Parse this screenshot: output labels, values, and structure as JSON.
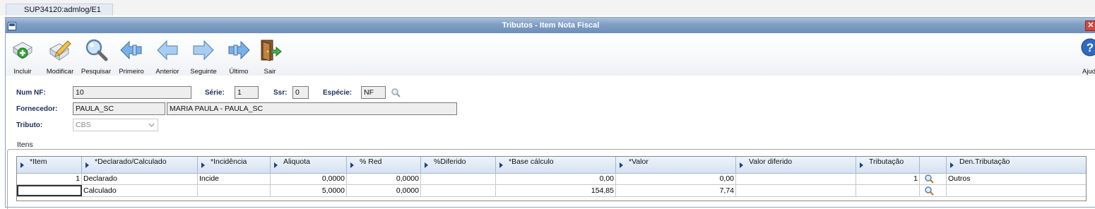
{
  "session_tab": "SUP34120:admlog/E1",
  "window": {
    "title": "Tributos - Item Nota Fiscal",
    "close_glyph": "✕"
  },
  "toolbar": {
    "items": [
      {
        "label": "Incluir",
        "icon": "add-icon"
      },
      {
        "label": "Modificar",
        "icon": "edit-icon"
      },
      {
        "label": "Pesquisar",
        "icon": "search-icon"
      },
      {
        "label": "Primeiro",
        "icon": "first-icon"
      },
      {
        "label": "Anterior",
        "icon": "previous-icon"
      },
      {
        "label": "Seguinte",
        "icon": "next-icon"
      },
      {
        "label": "Último",
        "icon": "last-icon"
      },
      {
        "label": "Sair",
        "icon": "exit-icon"
      }
    ],
    "help": {
      "label": "Ajud",
      "icon": "help-icon",
      "glyph": "?"
    }
  },
  "form": {
    "num_nf": {
      "label": "Num NF:",
      "value": "10"
    },
    "serie": {
      "label": "Série:",
      "value": "1"
    },
    "ssr": {
      "label": "Ssr:",
      "value": "0"
    },
    "especie": {
      "label": "Espécie:",
      "value": "NF"
    },
    "fornecedor": {
      "label": "Fornecedor:",
      "code": "PAULA_SC",
      "name": "MARIA PAULA - PAULA_SC"
    },
    "tributo": {
      "label": "Tributo:",
      "value": "CBS"
    }
  },
  "itens": {
    "group_label": "Itens",
    "columns": [
      "*Item",
      "*Declarado/Calculado",
      "*Incidência",
      "Aliquota",
      "% Red",
      "%Diferido",
      "*Base cálculo",
      "*Valor",
      "Valor diferido",
      "Tributação",
      "",
      "Den.Tributação"
    ],
    "rows": [
      [
        "1",
        "Declarado",
        "Incide",
        "0,0000",
        "0,0000",
        "",
        "0,00",
        "0,00",
        "",
        "1",
        "",
        "Outros"
      ],
      [
        "",
        "Calculado",
        "",
        "5,0000",
        "0,0000",
        "",
        "154,85",
        "7,74",
        "",
        "",
        "",
        ""
      ]
    ]
  },
  "colors": {
    "title_bar": "#7f9ec4",
    "header_arrow": "#1f3f88",
    "close": "#d5463b"
  }
}
